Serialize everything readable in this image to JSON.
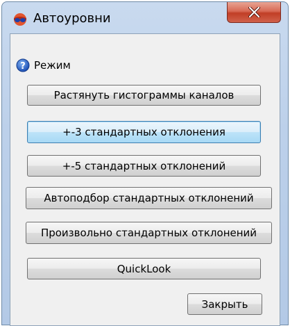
{
  "window": {
    "title": "Автоуровни",
    "app_icon": "stereo-glasses-icon",
    "close_icon": "close-icon"
  },
  "mode": {
    "label": "Режим",
    "icon": "help-icon"
  },
  "buttons": {
    "stretch": "Растянуть гистограммы каналов",
    "std3": "+-3 стандартных отклонения",
    "std5": "+-5 стандартных отклонений",
    "auto_std": "Автоподбор стандартных отклонений",
    "custom_std": "Произвольно стандартных отклонений",
    "quicklook": "QuickLook",
    "close": "Закрыть"
  },
  "colors": {
    "close_button": "#c13e26",
    "focused_button": "#a7d9f5"
  }
}
